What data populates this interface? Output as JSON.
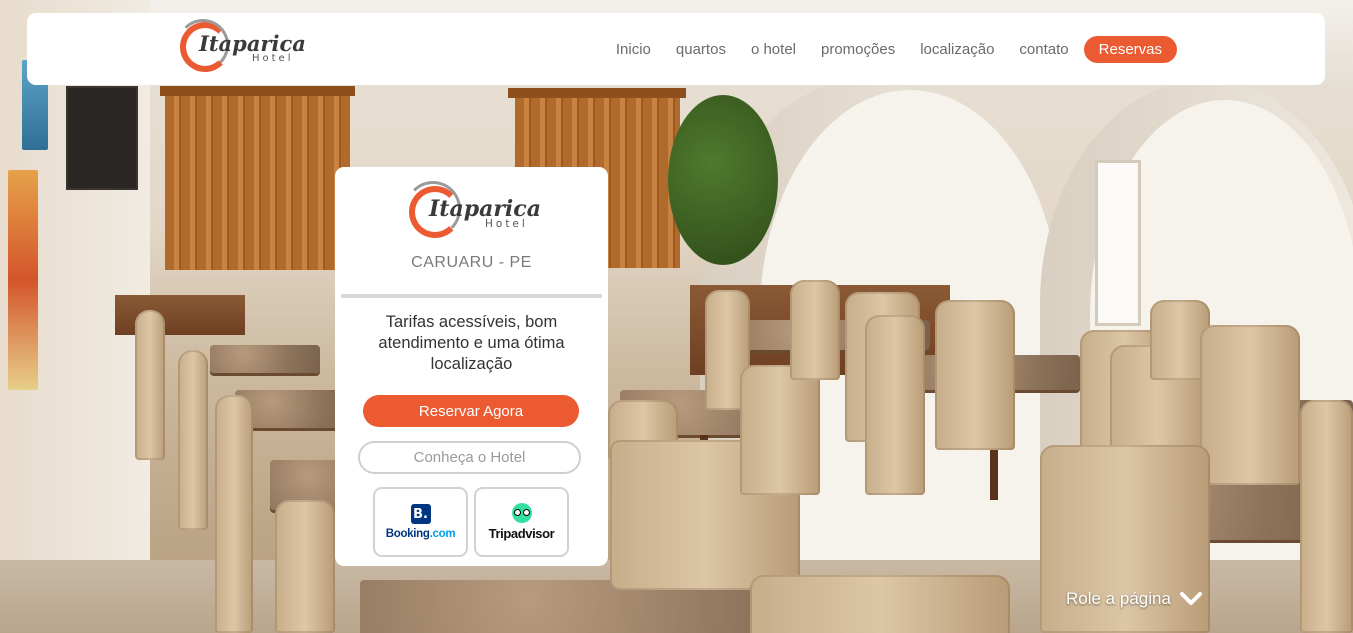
{
  "brand": {
    "name": "Itaparica",
    "subtitle": "Hotel",
    "accent_color": "#ec5a32"
  },
  "nav": {
    "items": [
      "Inicio",
      "quartos",
      "o hotel",
      "promoções",
      "localização",
      "contato"
    ],
    "reserve_label": "Reservas"
  },
  "card": {
    "city": "CARUARU - PE",
    "tagline": "Tarifas acessíveis, bom atendimento e uma ótima localização",
    "primary_button": "Reservar Agora",
    "secondary_button": "Conheça o Hotel",
    "booking": {
      "icon_letter": "B.",
      "name": "Booking",
      "suffix": ".com"
    },
    "tripadvisor": {
      "name": "Tripadvisor"
    }
  },
  "scroll_hint": {
    "label": "Role a página",
    "icon": "chevron-down-icon"
  }
}
